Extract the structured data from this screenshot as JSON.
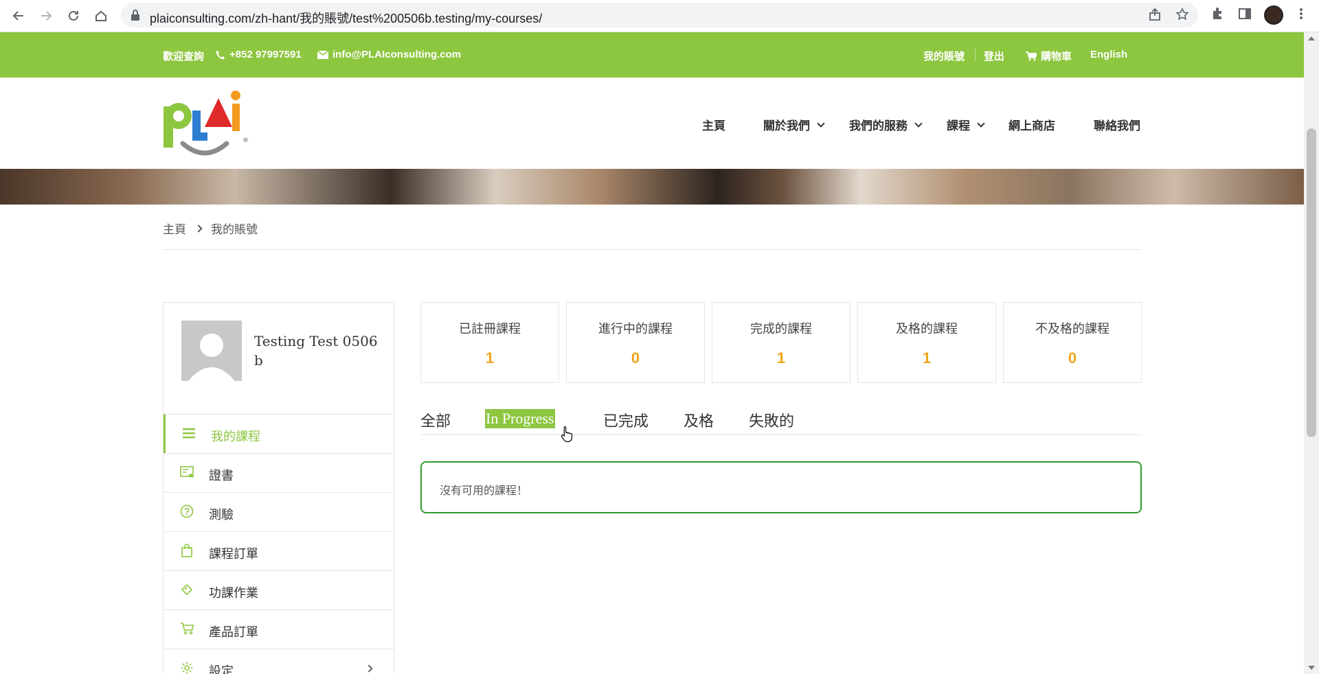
{
  "browser": {
    "url": "plaiconsulting.com/zh-hant/我的賬號/test%200506b.testing/my-courses/",
    "back_icon": "arrow-left-icon",
    "forward_icon": "arrow-right-icon",
    "reload_icon": "reload-icon",
    "home_icon": "home-icon"
  },
  "topbar": {
    "welcome": "歡迎查詢",
    "phone": "+852 97997591",
    "email": "info@PLAIconsulting.com",
    "my_account": "我的賬號",
    "logout": "登出",
    "cart": "購物車",
    "language": "English",
    "bg_color": "#8dc63f"
  },
  "nav": {
    "items": [
      {
        "label": "主頁"
      },
      {
        "label": "關於我們"
      },
      {
        "label": "我們的服務"
      },
      {
        "label": "課程"
      },
      {
        "label": "網上商店"
      },
      {
        "label": "聯絡我們"
      }
    ]
  },
  "breadcrumb": {
    "home": "主頁",
    "current": "我的賬號"
  },
  "profile": {
    "name": "Testing Test 0506 b"
  },
  "sidebar": {
    "items": [
      {
        "label": "我的課程",
        "icon": "list-icon"
      },
      {
        "label": "證書",
        "icon": "certificate-icon"
      },
      {
        "label": "測驗",
        "icon": "question-icon"
      },
      {
        "label": "課程訂單",
        "icon": "shopping-bag-icon"
      },
      {
        "label": "功課作業",
        "icon": "assignment-icon"
      },
      {
        "label": "產品訂單",
        "icon": "cart-icon"
      },
      {
        "label": "設定",
        "icon": "gear-icon"
      }
    ]
  },
  "stats": [
    {
      "label": "已註冊課程",
      "value": "1"
    },
    {
      "label": "進行中的課程",
      "value": "0"
    },
    {
      "label": "完成的課程",
      "value": "1"
    },
    {
      "label": "及格的課程",
      "value": "1"
    },
    {
      "label": "不及格的課程",
      "value": "0"
    }
  ],
  "tabs": [
    {
      "label": "全部"
    },
    {
      "label": "In Progress"
    },
    {
      "label": "已完成"
    },
    {
      "label": "及格"
    },
    {
      "label": "失敗的"
    }
  ],
  "notice": {
    "text": "沒有可用的課程！"
  },
  "colors": {
    "accent": "#8dc63f",
    "stat_value": "#f0a51c",
    "notice_border": "#2e9b2e"
  }
}
